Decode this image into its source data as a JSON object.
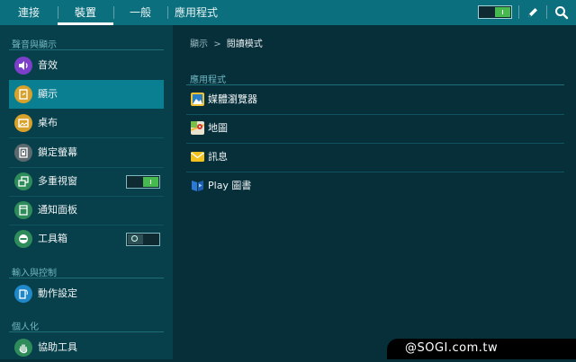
{
  "tabs": [
    {
      "label": "連接"
    },
    {
      "label": "裝置"
    },
    {
      "label": "一般"
    },
    {
      "label": "應用程式"
    }
  ],
  "active_tab": "裝置",
  "sidebar": {
    "sections": [
      {
        "title": "聲音與顯示"
      },
      {
        "title": "輸入與控制"
      },
      {
        "title": "個人化"
      }
    ],
    "items": [
      {
        "label": "音效",
        "icon": "speaker-icon",
        "color": "#7b3fc9"
      },
      {
        "label": "顯示",
        "icon": "display-icon",
        "color": "#d8a12a",
        "selected": true
      },
      {
        "label": "桌布",
        "icon": "wallpaper-icon",
        "color": "#d8a12a"
      },
      {
        "label": "鎖定螢幕",
        "icon": "lock-screen-icon",
        "color": "#5c6a70"
      },
      {
        "label": "多重視窗",
        "icon": "multi-window-icon",
        "color": "#2e8c5a",
        "toggle": "on"
      },
      {
        "label": "通知面板",
        "icon": "notification-panel-icon",
        "color": "#2e8c5a"
      },
      {
        "label": "工具箱",
        "icon": "toolbox-icon",
        "color": "#2e8c5a",
        "toggle": "off"
      },
      {
        "label": "動作設定",
        "icon": "motion-icon",
        "color": "#1e88c9"
      },
      {
        "label": "協助工具",
        "icon": "accessibility-icon",
        "color": "#2e8c5a"
      }
    ]
  },
  "breadcrumb": {
    "parent": "顯示",
    "separator": ">",
    "current": "閱讀模式"
  },
  "content": {
    "section_title": "應用程式",
    "apps": [
      {
        "label": "媒體瀏覽器",
        "icon": "media-browser-icon"
      },
      {
        "label": "地圖",
        "icon": "maps-icon"
      },
      {
        "label": "訊息",
        "icon": "messages-icon"
      },
      {
        "label": "Play 圖書",
        "icon": "play-books-icon"
      }
    ]
  },
  "topbar_icons": [
    "master-toggle",
    "pen-icon",
    "search-icon"
  ],
  "watermark": "@SOGI.com.tw",
  "colors": {
    "topbar": "#0b6f7e",
    "sidebar": "#07404b",
    "content": "#062f3a",
    "selected": "#0a7f91",
    "toggle_on": "#46b94f"
  }
}
